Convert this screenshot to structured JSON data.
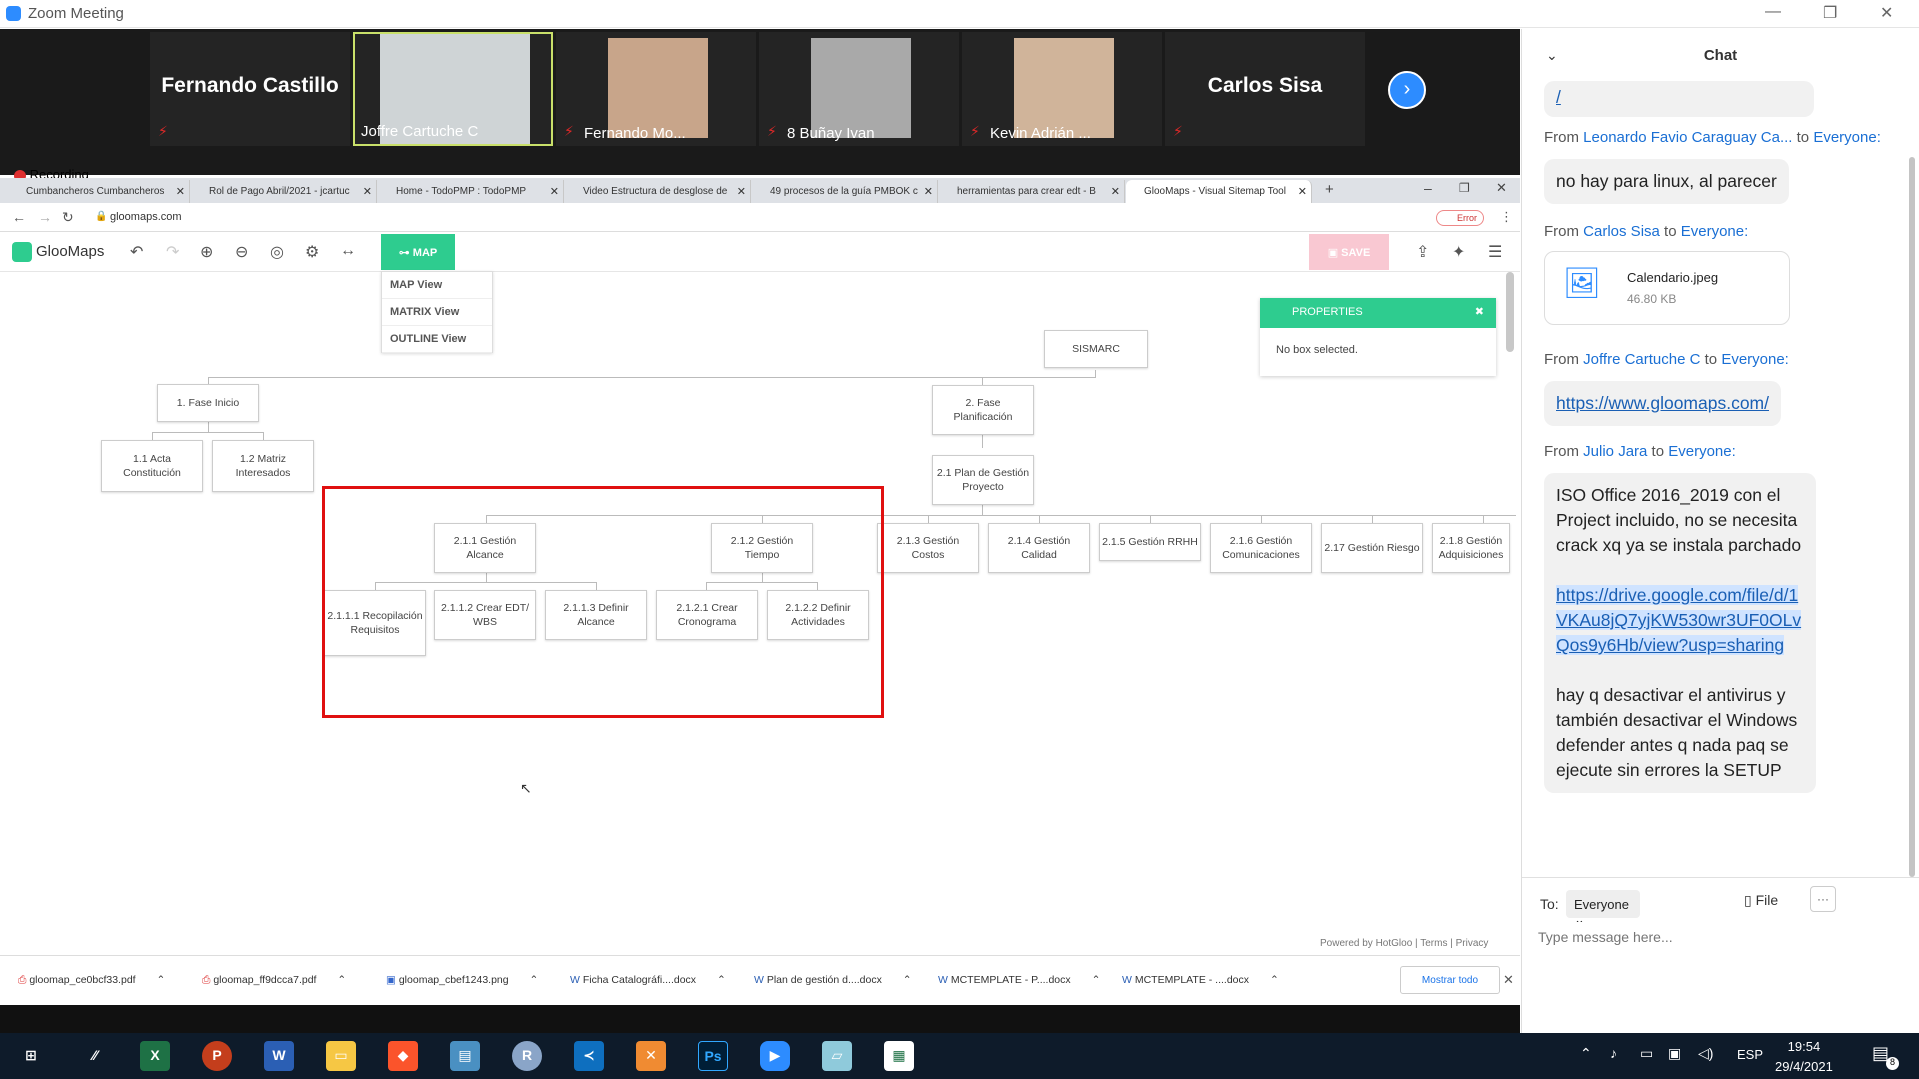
{
  "window": {
    "title": "Zoom Meeting"
  },
  "participants": [
    {
      "name": "Fernando Castillo",
      "video": false
    },
    {
      "name": "Joffre Cartuche C",
      "video": true
    },
    {
      "name": "Fernando Mo...",
      "video": true
    },
    {
      "name": "8 Buñay Ivan",
      "video": true
    },
    {
      "name": "Kevin Adrián ...",
      "video": true
    },
    {
      "name": "Carlos Sisa",
      "video": false
    }
  ],
  "recording_label": "Recording",
  "browser": {
    "tabs": [
      "Cumbancheros Cumbancheros",
      "Rol de Pago Abril/2021 - jcartuc",
      "Home - TodoPMP : TodoPMP",
      "Video Estructura de desglose de",
      "49 procesos de la guía PMBOK c",
      "herramientas para crear edt - B",
      "GlooMaps - Visual Sitemap Tool"
    ],
    "url": "gloomaps.com",
    "profile_status": "Error"
  },
  "gloomaps": {
    "logo": "GlooMaps",
    "map_button": "MAP",
    "save_button": "SAVE",
    "view_menu": [
      "MAP View",
      "MATRIX View",
      "OUTLINE View"
    ],
    "properties_title": "PROPERTIES",
    "properties_body": "No box selected.",
    "powered": "Powered by HotGloo | Terms | Privacy"
  },
  "sitemap": {
    "root": "SISMARC",
    "nodes": {
      "f1": "1. Fase Inicio",
      "a11": "1.1 Acta Constitución",
      "a12": "1.2 Matriz Interesados",
      "f2": "2. Fase Planificación",
      "p21": "2.1 Plan de Gestión Proyecto",
      "g211": "2.1.1 Gestión Alcance",
      "g212": "2.1.2 Gestión Tiempo",
      "g213": "2.1.3 Gestión Costos",
      "g214": "2.1.4 Gestión Calidad",
      "g215": "2.1.5 Gestión RRHH",
      "g216": "2.1.6 Gestión Comunicaciones",
      "g217": "2.17 Gestión Riesgo",
      "g218": "2.1.8 Gestión Adquisiciones",
      "s2111": "2.1.1.1 Recopilación Requisitos",
      "s2112": "2.1.1.2 Crear EDT/ WBS",
      "s2113": "2.1.1.3 Definir Alcance",
      "s2121": "2.1.2.1 Crear Cronograma",
      "s2122": "2.1.2.2 Definir Actividades"
    }
  },
  "downloads": {
    "items": [
      "gloomap_ce0bcf33.pdf",
      "gloomap_ff9dcca7.pdf",
      "gloomap_cbef1243.png",
      "Ficha Catalográfi....docx",
      "Plan de gestión d....docx",
      "MCTEMPLATE - P....docx",
      "MCTEMPLATE - ....docx"
    ],
    "show_all": "Mostrar todo"
  },
  "chat": {
    "title": "Chat",
    "messages": [
      {
        "from": "Leonardo Favio Caraguay Ca...",
        "to": "Everyone:",
        "text": "no hay para linux, al parecer"
      },
      {
        "from": "Carlos Sisa",
        "to": "Everyone:",
        "file_name": "Calendario.jpeg",
        "file_size": "46.80 KB"
      },
      {
        "from": "Joffre Cartuche C",
        "to": "Everyone:",
        "link": "https://www.gloomaps.com/"
      },
      {
        "from": "Julio Jara",
        "to": "Everyone:",
        "text": "ISO Office 2016_2019 con el Project incluido, no se necesita crack xq ya se instala parchado",
        "link": "https://drive.google.com/file/d/1VKAu8jQ7yjKW530wr3UF0OLvQos9y6Hb/view?usp=sharing",
        "text2": "hay q desactivar el antivirus y también desactivar el Windows defender antes q nada paq se ejecute sin errores la SETUP"
      }
    ],
    "from_word": "From",
    "to_word": "to",
    "to_label": "To:",
    "to_value": "Everyone",
    "file_button": "File",
    "placeholder": "Type message here..."
  },
  "taskbar": {
    "lang": "ESP",
    "time": "19:54",
    "date": "29/4/2021",
    "notifications": "8"
  }
}
